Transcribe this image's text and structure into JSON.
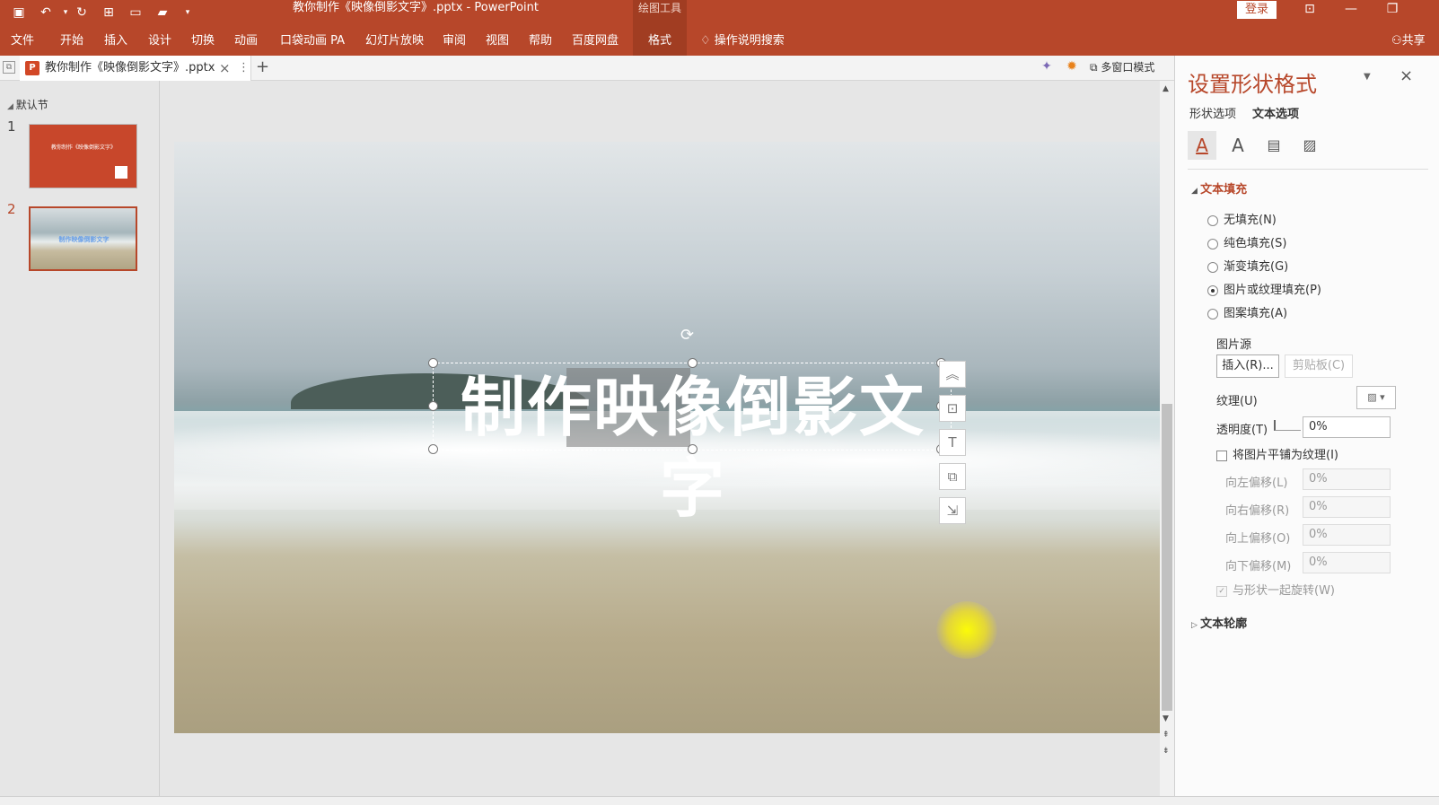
{
  "titlebar": {
    "document_title": "教你制作《映像倒影文字》.pptx - PowerPoint",
    "context_group": "绘图工具",
    "login_label": "登录",
    "minimize_glyph": "—",
    "restore_glyph": "❐",
    "ribbon_toggle_glyph": "⊡"
  },
  "ribbon": {
    "tabs": [
      "文件",
      "开始",
      "插入",
      "设计",
      "切换",
      "动画",
      "口袋动画 PA",
      "幻灯片放映",
      "审阅",
      "视图",
      "帮助",
      "百度网盘"
    ],
    "format_tab": "格式",
    "tell_me": "操作说明搜索",
    "share": "共享"
  },
  "docstrip": {
    "tab_label": "教你制作《映像倒影文字》.pptx",
    "ppt_badge": "P",
    "multi_window": "多窗口模式",
    "add_glyph": "+",
    "close_glyph": "×"
  },
  "thumbpane": {
    "section": "默认节",
    "slides": [
      {
        "number": "1",
        "title": "教你制作《映像倒影文字》"
      },
      {
        "number": "2",
        "title": "制作映像倒影文字"
      }
    ]
  },
  "slide": {
    "heading": "制作映像倒影文字"
  },
  "format_pane": {
    "title": "设置形状格式",
    "tabs": [
      "形状选项",
      "文本选项"
    ],
    "section_text_fill": "文本填充",
    "fill_options": [
      "无填充(N)",
      "纯色填充(S)",
      "渐变填充(G)",
      "图片或纹理填充(P)",
      "图案填充(A)"
    ],
    "selected_fill": 3,
    "picture_source": "图片源",
    "insert_button": "插入(R)...",
    "clipboard_button": "剪贴板(C)",
    "texture_label": "纹理(U)",
    "transparency_label": "透明度(T)",
    "transparency_value": "0%",
    "tile_label": "将图片平铺为纹理(I)",
    "offsets": [
      {
        "label": "向左偏移(L)",
        "value": "0%"
      },
      {
        "label": "向右偏移(R)",
        "value": "0%"
      },
      {
        "label": "向上偏移(O)",
        "value": "0%"
      },
      {
        "label": "向下偏移(M)",
        "value": "0%"
      }
    ],
    "rotate_with_shape": "与形状一起旋转(W)",
    "section_text_outline": "文本轮廓"
  },
  "colors": {
    "accent": "#b7472a",
    "accent_dark": "#a13d22"
  }
}
